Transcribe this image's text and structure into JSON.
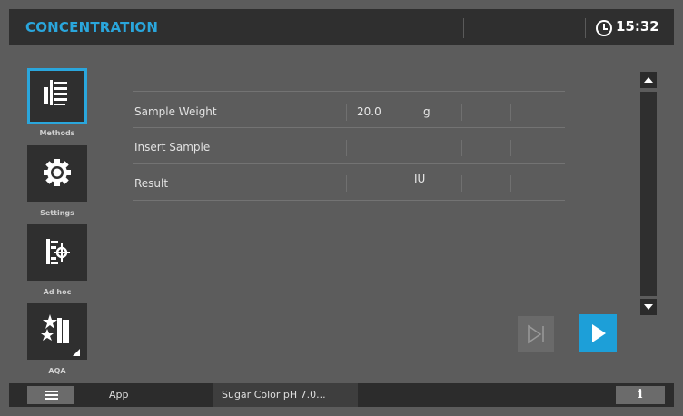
{
  "header": {
    "title": "CONCENTRATION",
    "time": "15:32"
  },
  "sidebar": {
    "items": [
      {
        "label": "Methods",
        "icon": "methods-icon",
        "selected": true
      },
      {
        "label": "Settings",
        "icon": "gear-icon",
        "selected": false
      },
      {
        "label": "Ad hoc",
        "icon": "ad-hoc-icon",
        "selected": false
      },
      {
        "label": "AQA",
        "icon": "aqa-icon",
        "selected": false
      }
    ]
  },
  "table": {
    "rows": [
      {
        "label": "Sample Weight",
        "value": "20.0",
        "unit": "g"
      },
      {
        "label": "Insert Sample",
        "value": "",
        "unit": ""
      },
      {
        "label": "Result",
        "value": "",
        "unit": "IU"
      }
    ]
  },
  "footer": {
    "app_label": "App",
    "method_name": "Sugar Color pH 7.0...",
    "info_label": "i"
  },
  "colors": {
    "accent": "#2aa6dc",
    "background": "#5c5c5c",
    "bar": "#2f2f2f",
    "play": "#1d9fd8"
  }
}
